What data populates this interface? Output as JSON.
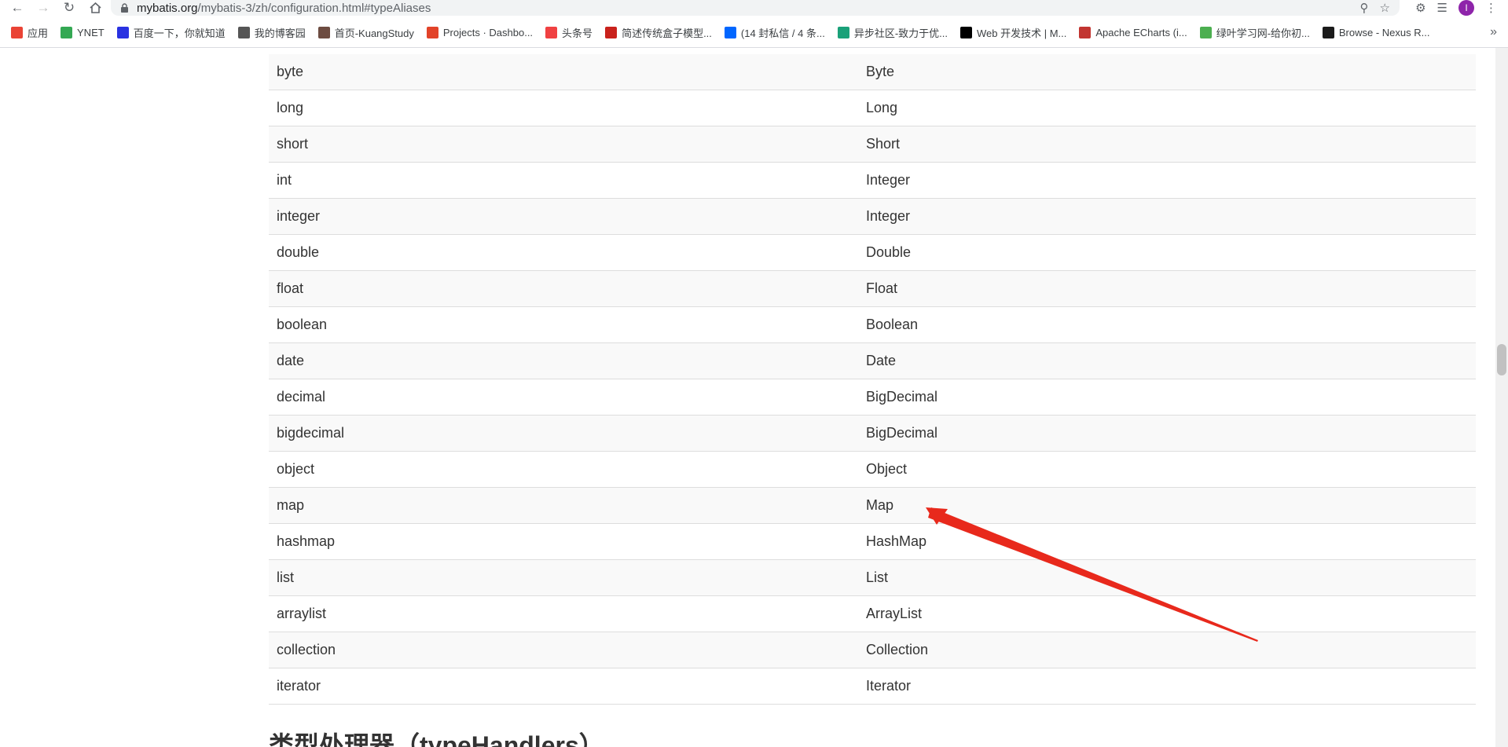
{
  "browser": {
    "url_host": "mybatis.org",
    "url_path": "/mybatis-3/zh/configuration.html#typeAliases",
    "profile_initial": "I",
    "bookmarks": [
      {
        "label": "应用",
        "icon": "apps-grid-icon",
        "color": "#ea4335"
      },
      {
        "label": "YNET",
        "icon": "ynet-icon",
        "color": "#34a853"
      },
      {
        "label": "百度一下，你就知道",
        "icon": "baidu-paw-icon",
        "color": "#2932e1"
      },
      {
        "label": "我的博客园",
        "icon": "cnblogs-icon",
        "color": "#555555"
      },
      {
        "label": "首页-KuangStudy",
        "icon": "kuangstudy-icon",
        "color": "#6d4c41"
      },
      {
        "label": "Projects · Dashbo...",
        "icon": "gitlab-icon",
        "color": "#e24329"
      },
      {
        "label": "头条号",
        "icon": "toutiao-icon",
        "color": "#f04142"
      },
      {
        "label": "简述传统盒子模型...",
        "icon": "csdn-icon",
        "color": "#c9221c"
      },
      {
        "label": "(14 封私信 / 4 条...",
        "icon": "zhihu-icon",
        "color": "#0066ff"
      },
      {
        "label": "异步社区-致力于优...",
        "icon": "epubit-icon",
        "color": "#1aa179"
      },
      {
        "label": "Web 开发技术 | M...",
        "icon": "mdn-icon",
        "color": "#000000"
      },
      {
        "label": "Apache ECharts (i...",
        "icon": "echarts-icon",
        "color": "#c23531"
      },
      {
        "label": "绿叶学习网-给你初...",
        "icon": "lvye-icon",
        "color": "#4caf50"
      },
      {
        "label": "Browse - Nexus R...",
        "icon": "nexus-icon",
        "color": "#1b1b1b"
      }
    ]
  },
  "table": {
    "rows": [
      [
        "byte",
        "Byte"
      ],
      [
        "long",
        "Long"
      ],
      [
        "short",
        "Short"
      ],
      [
        "int",
        "Integer"
      ],
      [
        "integer",
        "Integer"
      ],
      [
        "double",
        "Double"
      ],
      [
        "float",
        "Float"
      ],
      [
        "boolean",
        "Boolean"
      ],
      [
        "date",
        "Date"
      ],
      [
        "decimal",
        "BigDecimal"
      ],
      [
        "bigdecimal",
        "BigDecimal"
      ],
      [
        "object",
        "Object"
      ],
      [
        "map",
        "Map"
      ],
      [
        "hashmap",
        "HashMap"
      ],
      [
        "list",
        "List"
      ],
      [
        "arraylist",
        "ArrayList"
      ],
      [
        "collection",
        "Collection"
      ],
      [
        "iterator",
        "Iterator"
      ]
    ]
  },
  "section_title": "类型处理器（typeHandlers）",
  "annotation": {
    "color": "#e8291c",
    "points_to": "Map"
  }
}
